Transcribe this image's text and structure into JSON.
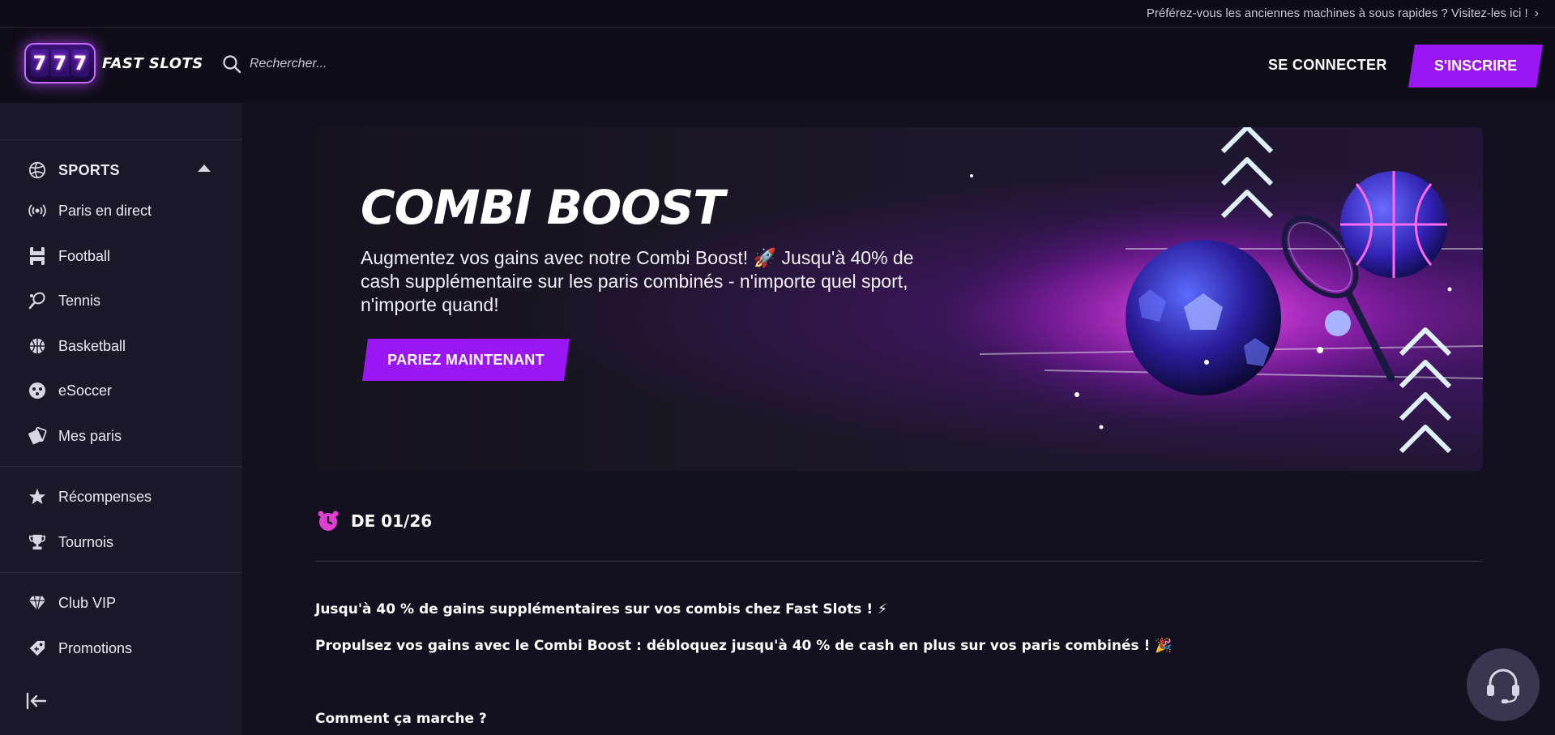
{
  "topbar": {
    "text": "Préférez-vous les anciennes machines à sous rapides ? Visitez-les ici !",
    "chevron": "›"
  },
  "header": {
    "logo_reels": [
      "7",
      "7",
      "7"
    ],
    "logo_text": "FAST SLOTS",
    "search_placeholder": "Rechercher...",
    "login_label": "SE CONNECTER",
    "signup_label": "S'INSCRIRE"
  },
  "sidebar": {
    "sports": {
      "label": "SPORTS",
      "icon": "volleyball-icon",
      "expanded": true
    },
    "items": [
      {
        "label": "Paris en direct",
        "icon": "live-broadcast-icon"
      },
      {
        "label": "Football",
        "icon": "football-pitch-icon"
      },
      {
        "label": "Tennis",
        "icon": "tennis-racket-icon"
      },
      {
        "label": "Basketball",
        "icon": "basketball-icon"
      },
      {
        "label": "eSoccer",
        "icon": "gamepad-icon"
      },
      {
        "label": "Mes paris",
        "icon": "tickets-icon"
      },
      {
        "label": "Récompenses",
        "icon": "star-icon"
      },
      {
        "label": "Tournois",
        "icon": "trophy-icon"
      },
      {
        "label": "Club VIP",
        "icon": "diamond-icon"
      },
      {
        "label": "Promotions",
        "icon": "tag-icon"
      }
    ],
    "collapse_icon": "collapse-left-icon"
  },
  "banner": {
    "title": "COMBI BOOST",
    "text": "Augmentez vos gains avec notre Combi Boost! 🚀 Jusqu'à 40% de cash supplémentaire sur les paris combinés - n'importe quel sport, n'importe quand!",
    "cta_label": "PARIEZ MAINTENANT"
  },
  "promo": {
    "date_label": "DE 01/26",
    "date_icon": "alarm-clock-icon",
    "line1": "Jusqu'à 40 % de gains supplémentaires sur vos combis chez Fast Slots ! ⚡",
    "line2": "Propulsez vos gains avec le Combi Boost : débloquez jusqu'à 40 % de cash en plus sur vos paris combinés ! 🎉",
    "heading": "Comment ça marche ?"
  },
  "support_icon": "headset-icon",
  "colors": {
    "accent": "#9a16f5",
    "background": "#13101f",
    "sidebar": "#1b1829",
    "alarm": "#e040d0"
  }
}
